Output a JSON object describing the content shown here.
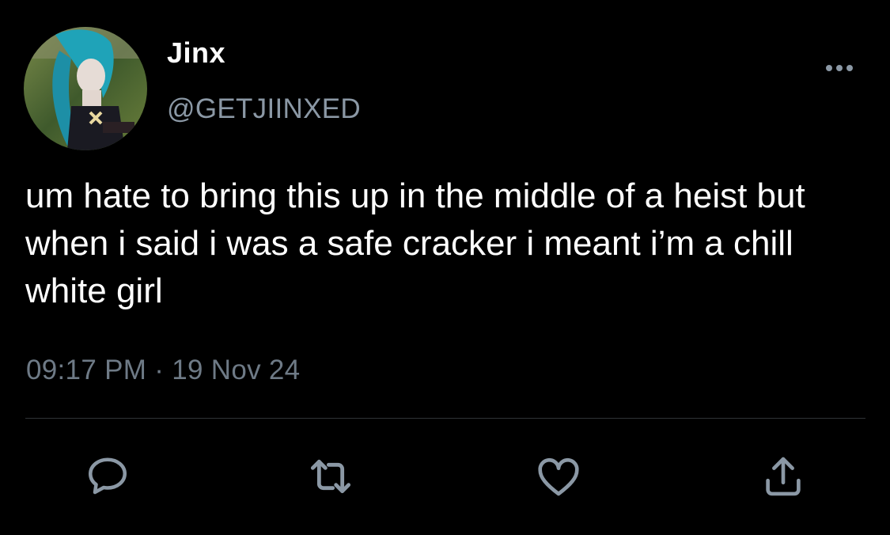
{
  "author": {
    "display_name": "Jinx",
    "handle": "@GETJIINXED",
    "avatar_icon": "profile-photo"
  },
  "tweet": {
    "text": "um hate to bring this up in the middle of a heist but when i said i was a safe cracker i meant i’m a chill white girl",
    "time": "09:17 PM",
    "separator": "·",
    "date": "19 Nov 24"
  },
  "actions": [
    {
      "name": "reply",
      "icon": "comment-bubble-icon"
    },
    {
      "name": "retweet",
      "icon": "retweet-arrows-icon"
    },
    {
      "name": "like",
      "icon": "heart-icon"
    },
    {
      "name": "share",
      "icon": "share-upload-icon"
    }
  ],
  "colors": {
    "background": "#000000",
    "primary_text": "#ffffff",
    "secondary_text": "#8b98a5",
    "icon": "#8b98a5",
    "divider": "#2f3336"
  }
}
